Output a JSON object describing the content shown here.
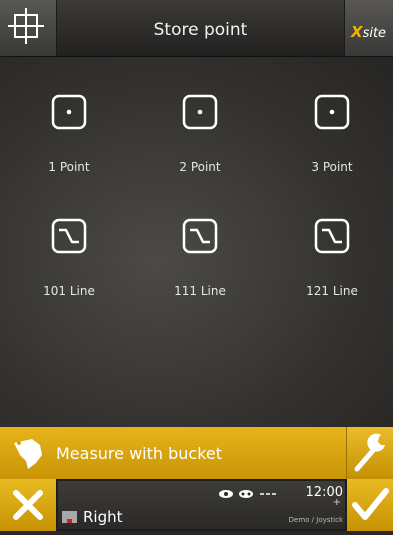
{
  "header": {
    "title": "Store point",
    "brand_x": "X",
    "brand_rest": "site"
  },
  "points": [
    {
      "label": "1 Point",
      "icon": "point-icon"
    },
    {
      "label": "2 Point",
      "icon": "point-icon"
    },
    {
      "label": "3 Point",
      "icon": "point-icon"
    },
    {
      "label": "101 Line",
      "icon": "line-icon"
    },
    {
      "label": "111 Line",
      "icon": "line-icon"
    },
    {
      "label": "121 Line",
      "icon": "line-icon"
    }
  ],
  "measure": {
    "label": "Measure with bucket",
    "icon": "bucket-icon",
    "settings_icon": "wrench-icon"
  },
  "status": {
    "side": "Right",
    "time": "12:00",
    "plus": "+",
    "mode": "Demo / Joystick"
  },
  "colors": {
    "accent": "#d9a50e",
    "background": "#2f2d2a"
  }
}
